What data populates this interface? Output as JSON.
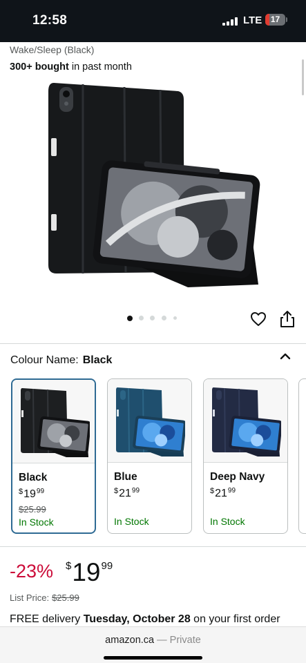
{
  "status_bar": {
    "time": "12:58",
    "network": "LTE",
    "battery_level": "17",
    "battery_color": "#e03c31"
  },
  "product": {
    "subtitle": "Wake/Sleep (Black)",
    "bought_bold": "300+ bought",
    "bought_rest": " in past month",
    "image_dots": 5,
    "active_dot": 0
  },
  "actions": {
    "favorite_icon": "heart-icon",
    "share_icon": "share-icon"
  },
  "colour": {
    "label": "Colour Name:",
    "selected": "Black",
    "collapse_icon": "chevron-up-icon",
    "options": [
      {
        "name": "Black",
        "currency": "$",
        "dollars": "19",
        "cents": "99",
        "was": "$25.99",
        "stock": "In Stock",
        "case_color": "#1d1f21",
        "screen_color": "#6d7077"
      },
      {
        "name": "Blue",
        "currency": "$",
        "dollars": "21",
        "cents": "99",
        "was": "",
        "stock": "In Stock",
        "case_color": "#1f4f6e",
        "screen_color": "#2f7fd0"
      },
      {
        "name": "Deep Navy",
        "currency": "$",
        "dollars": "21",
        "cents": "99",
        "was": "",
        "stock": "In Stock",
        "case_color": "#232b44",
        "screen_color": "#2f7fd0"
      }
    ]
  },
  "pricing": {
    "discount": "-23%",
    "currency": "$",
    "dollars": "19",
    "cents": "99",
    "list_price_label": "List Price:",
    "list_price": "$25.99",
    "discount_color": "#cc0c39"
  },
  "delivery": {
    "prefix": "FREE delivery ",
    "date": "Tuesday, October 28",
    "suffix": " on your first order"
  },
  "browser": {
    "domain": "amazon.ca",
    "separator": " — ",
    "mode": "Private"
  }
}
